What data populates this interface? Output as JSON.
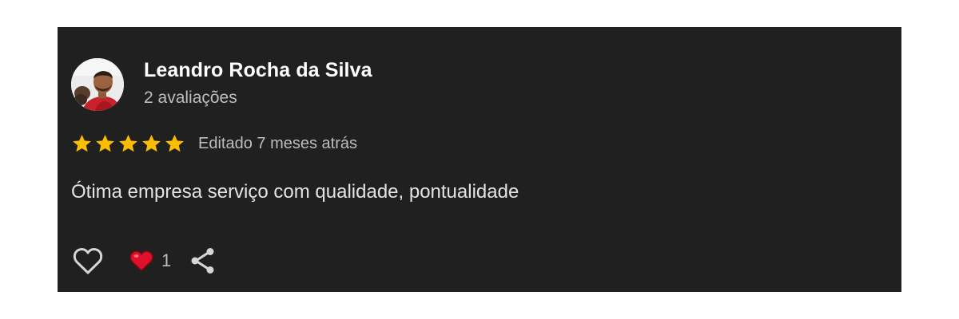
{
  "review": {
    "reviewer_name": "Leandro Rocha da Silva",
    "review_count": "2 avaliações",
    "rating": 5,
    "rating_max": 5,
    "edited_date": "Editado 7 meses atrás",
    "text": "Ótima empresa serviço com qualidade, pontualidade",
    "reaction_count": "1"
  },
  "icons": {
    "avatar": "profile-photo",
    "star": "star-icon",
    "like": "heart-outline-icon",
    "reaction": "red-heart-emoji-icon",
    "share": "share-icon"
  },
  "colors": {
    "card_background": "#202020",
    "star": "#fbbc04",
    "reaction_heart": "#e0102a",
    "secondary_text": "#bdbdbd"
  }
}
